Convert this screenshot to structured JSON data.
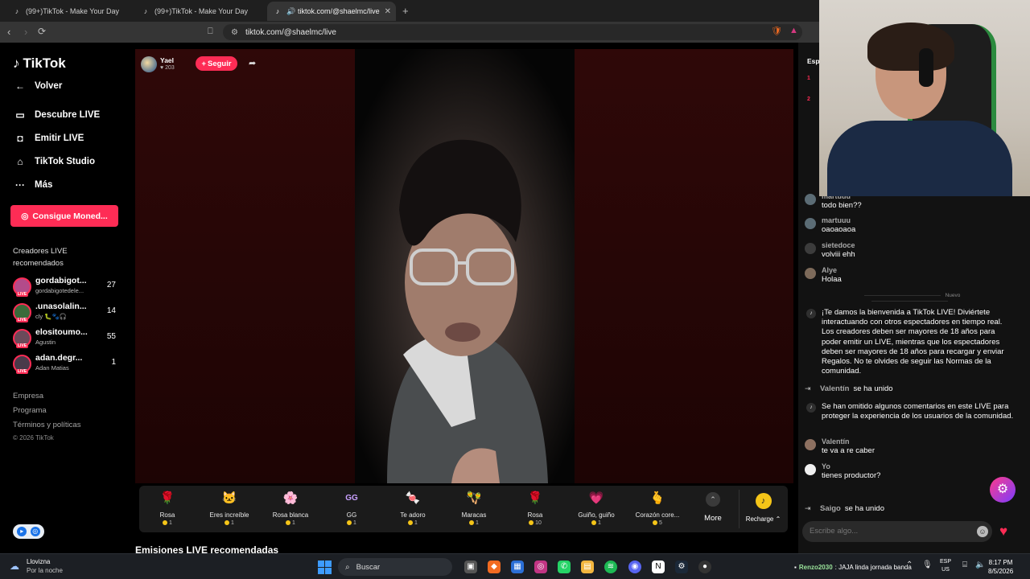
{
  "browser": {
    "tabs": [
      {
        "label": "(99+)TikTok - Make Your Day",
        "favicon": "tiktok-icon"
      },
      {
        "label": "(99+)TikTok - Make Your Day",
        "favicon": "tiktok-icon"
      },
      {
        "label": "tiktok.com/@shaelmc/live",
        "favicon": "tiktok-icon",
        "active": true
      }
    ],
    "url": "tiktok.com/@shaelmc/live"
  },
  "sidebar": {
    "logo": "TikTok",
    "nav": [
      {
        "label": "Volver",
        "icon": "arrow-left-icon"
      },
      {
        "label": "Descubre LIVE",
        "icon": "live-discover-icon"
      },
      {
        "label": "Emitir LIVE",
        "icon": "camera-icon"
      },
      {
        "label": "TikTok Studio",
        "icon": "studio-icon"
      },
      {
        "label": "Más",
        "icon": "more-dots-icon"
      }
    ],
    "coins_button": "Consigue Moned...",
    "recommended_title": "Creadores LIVE recomendados",
    "creators": [
      {
        "name": "gordabigot...",
        "sub": "gordabigotedele...",
        "count": "27"
      },
      {
        "name": ".unasolalin...",
        "sub": "cly 🐛🐾🎧",
        "count": "14"
      },
      {
        "name": "elositoumo...",
        "sub": "Agustin",
        "count": "55"
      },
      {
        "name": "adan.degr...",
        "sub": "Adan Matias",
        "count": "1"
      }
    ],
    "footer_links": [
      "Empresa",
      "Programa",
      "Términos y políticas"
    ],
    "copyright": "© 2026 TikTok"
  },
  "host": {
    "name": "Yael",
    "likes": "203",
    "follow_label": "Seguir"
  },
  "gifts": [
    {
      "name": "Rosa",
      "price": "1",
      "icon": "🌹"
    },
    {
      "name": "Eres increíble",
      "price": "1",
      "icon": "🐱"
    },
    {
      "name": "Rosa blanca",
      "price": "1",
      "icon": "🌸"
    },
    {
      "name": "GG",
      "price": "1",
      "icon": "GG"
    },
    {
      "name": "Te adoro",
      "price": "1",
      "icon": "🍬"
    },
    {
      "name": "Maracas",
      "price": "1",
      "icon": "🪇"
    },
    {
      "name": "Rosa",
      "price": "10",
      "icon": "🌹"
    },
    {
      "name": "Guiño, guiño",
      "price": "1",
      "icon": "💗"
    },
    {
      "name": "Corazón core...",
      "price": "5",
      "icon": "🫰"
    }
  ],
  "gift_more": "More",
  "recharge": "Recharge",
  "recommended_heading": "Emisiones LIVE recomendadas",
  "chat": {
    "header": "Esp",
    "ranks": [
      "1",
      "2"
    ],
    "messages": [
      {
        "name": "martuuu",
        "text": "todo bien??"
      },
      {
        "name": "martuuu",
        "text": "oaoaoaoa"
      },
      {
        "name": "sietedoce",
        "text": "volviii ehh"
      },
      {
        "name": "Alye",
        "text": "Holaa"
      }
    ],
    "new_divider": "Nuevo",
    "welcome": "¡Te damos la bienvenida a TikTok LIVE! Diviértete interactuando con otros espectadores en tiempo real. Los creadores deben ser mayores de 18 años para poder emitir un LIVE, mientras que los espectadores deben ser mayores de 18 años para recargar y enviar Regalos. No te olvides de seguir las Normas de la comunidad.",
    "joined1": {
      "name": "Valentín",
      "text": "se ha unido"
    },
    "omitted": "Se han omitido algunos comentarios en este LIVE para proteger la experiencia de los usuarios de la comunidad.",
    "messages2": [
      {
        "name": "Valentín",
        "text": "te va a re caber"
      },
      {
        "name": "Yo",
        "text": "tienes productor?"
      }
    ],
    "joined2": {
      "name": "Saigo",
      "text": "se ha unido"
    },
    "input_placeholder": "Escribe algo..."
  },
  "taskbar": {
    "weather_title": "Llovizna",
    "weather_sub": "Por la noche",
    "search": "Buscar",
    "notification_user": "Renzo2030",
    "notification_text": ": JAJA linda jornada banda",
    "lang_top": "ESP",
    "lang_bottom": "US",
    "time": "8:17 PM",
    "date": "8/5/2026"
  },
  "colors": {
    "accent": "#fe2c55",
    "background": "#000000",
    "chat_bg": "#121212",
    "stage_bg": "#2a0707"
  }
}
